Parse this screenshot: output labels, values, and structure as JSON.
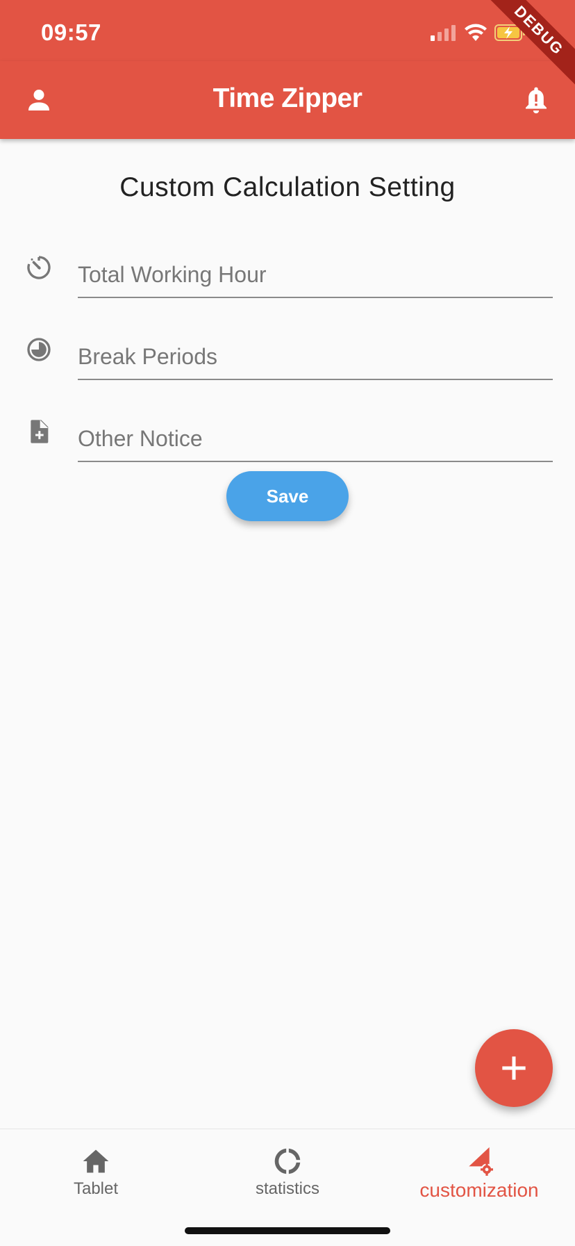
{
  "status_bar": {
    "time": "09:57",
    "icons": [
      "signal-icon",
      "wifi-icon",
      "battery-charging-icon"
    ]
  },
  "debug_banner": "DEBUG",
  "app_bar": {
    "title": "Time Zipper",
    "left_icon": "person-icon",
    "right_icon": "bell-alert-icon",
    "color": "#e25444"
  },
  "form": {
    "heading": "Custom Calculation Setting",
    "fields": [
      {
        "icon": "timer-icon",
        "placeholder": "Total Working Hour",
        "value": ""
      },
      {
        "icon": "clock-icon",
        "placeholder": "Break Periods",
        "value": ""
      },
      {
        "icon": "note-add-icon",
        "placeholder": "Other Notice",
        "value": ""
      }
    ],
    "save_label": "Save",
    "save_color": "#4aa3e8"
  },
  "fab": {
    "icon": "plus-icon"
  },
  "bottom_nav": {
    "items": [
      {
        "label": "Tablet",
        "icon": "home-icon",
        "active": false
      },
      {
        "label": "statistics",
        "icon": "donut-icon",
        "active": false
      },
      {
        "label": "customization",
        "icon": "settings-triangle-icon",
        "active": true
      }
    ],
    "active_color": "#e25444"
  }
}
